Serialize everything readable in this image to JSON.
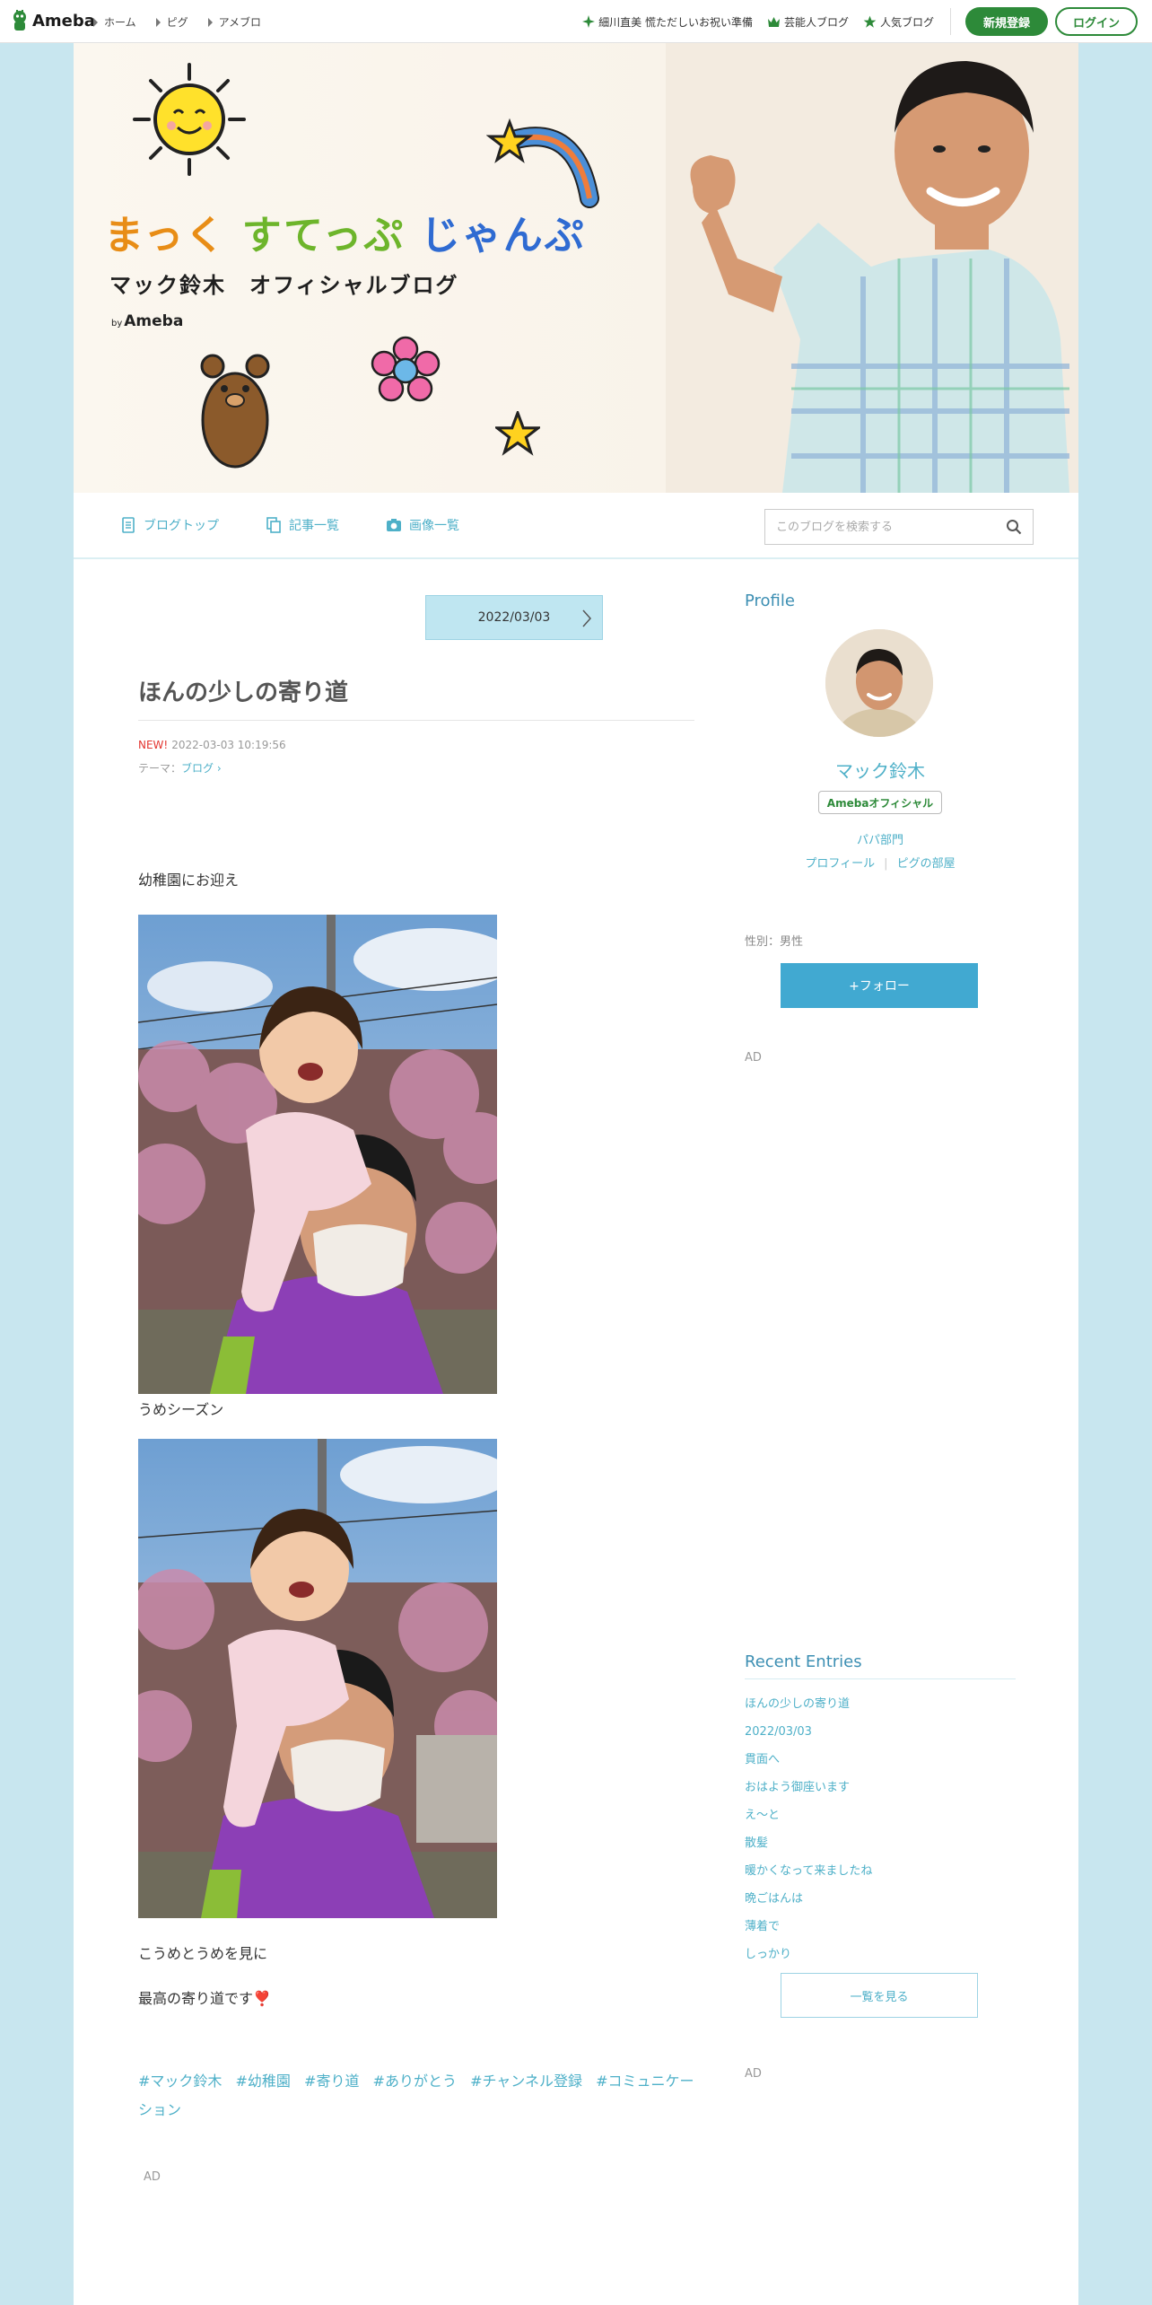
{
  "global_nav": {
    "logo_text": "Ameba",
    "left_items": [
      "ホーム",
      "ピグ",
      "アメブロ"
    ],
    "right_items": [
      {
        "icon": "sparkle-icon",
        "label": "細川直美 慌ただしいお祝い準備"
      },
      {
        "icon": "crown-icon",
        "label": "芸能人ブログ"
      },
      {
        "icon": "star-icon",
        "label": "人気ブログ"
      }
    ],
    "register_label": "新規登録",
    "login_label": "ログイン"
  },
  "banner": {
    "title_part1": "まっく",
    "title_part2": "すてっぷ",
    "title_part3": "じゃんぷ",
    "subtitle": "マック鈴木　オフィシャルブログ",
    "by_prefix": "by",
    "by_brand": "Ameba"
  },
  "blog_nav": {
    "items": [
      "ブログトップ",
      "記事一覧",
      "画像一覧"
    ],
    "search_placeholder": "このブログを検索する"
  },
  "entry": {
    "date_button": "2022/03/03",
    "title": "ほんの少しの寄り道",
    "new_label": "NEW!",
    "timestamp": "2022-03-03 10:19:56",
    "theme_prefix": "テーマ：",
    "theme": "ブログ",
    "body_1": "幼稚園にお迎え",
    "caption_1": "うめシーズン",
    "body_2": "こうめとうめを見に",
    "body_3": "最高の寄り道です❣️",
    "tags": [
      "#マック鈴木",
      "#幼稚園",
      "#寄り道",
      "#ありがとう",
      "#チャンネル登録",
      "#コミュニケーション"
    ],
    "ad_label": "AD"
  },
  "sidebar": {
    "profile_heading": "Profile",
    "name": "マック鈴木",
    "badge": "Amebaオフィシャル",
    "category": "パパ部門",
    "links": [
      "プロフィール",
      "ピグの部屋"
    ],
    "gender": "性別：男性",
    "follow_label": "+フォロー",
    "ad_label": "AD",
    "recent_heading": "Recent Entries",
    "recent_entries": [
      "ほんの少しの寄り道",
      "2022/03/03",
      "貫面へ",
      "おはよう御座います",
      "え〜と",
      "散髪",
      "暖かくなって来ましたね",
      "晩ごはんは",
      "薄着で",
      "しっかり"
    ],
    "more_label": "一覧を見る",
    "ad_label_2": "AD"
  },
  "colors": {
    "page_bg": "#c8e6ef",
    "accent_blue": "#4eb0c8",
    "ameba_green": "#2d8a39",
    "follow_blue": "#41a9d1"
  }
}
